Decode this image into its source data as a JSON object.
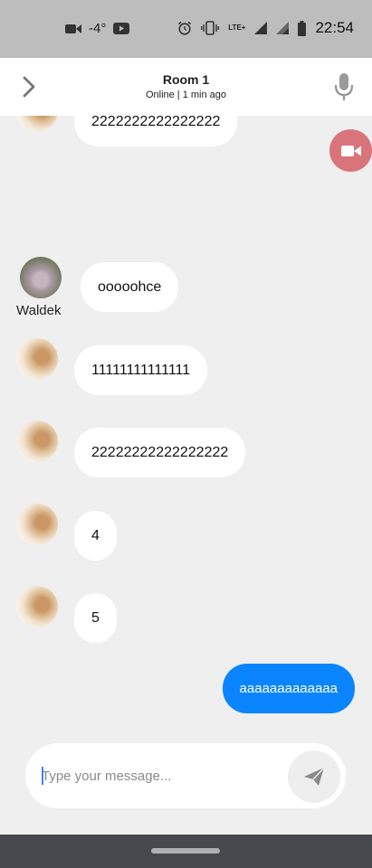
{
  "status_bar": {
    "temperature": "-4°",
    "time": "22:54",
    "network": "LTE+"
  },
  "header": {
    "title": "Room 1",
    "status": "Online | 1 min ago"
  },
  "messages": [
    {
      "sender_label": "",
      "text": "2222222222222222"
    },
    {
      "sender_label": "Waldek",
      "text": "ooooohce"
    },
    {
      "sender_label": "",
      "text": "11111111111111"
    },
    {
      "sender_label": "",
      "text": "22222222222222222"
    },
    {
      "sender_label": "",
      "text": "4"
    },
    {
      "sender_label": "",
      "text": "5"
    },
    {
      "sender_label": "",
      "text": "aaaaaaaaaaaaa"
    }
  ],
  "composer": {
    "placeholder": "Type your message...",
    "value": ""
  },
  "icons": {
    "back": "chevron-right-icon",
    "mic": "microphone-icon",
    "video": "video-camera-icon",
    "send": "send-icon"
  },
  "colors": {
    "outgoing_bubble": "#0a84ff",
    "video_fab": "#d9747a",
    "header_bg": "#ffffff",
    "chat_bg": "#efefef"
  }
}
